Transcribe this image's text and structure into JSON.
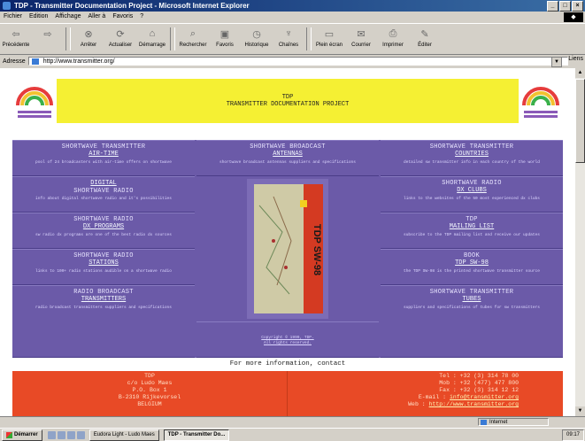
{
  "window": {
    "title": "TDP - Transmitter Documentation Project - Microsoft Internet Explorer",
    "win_buttons": [
      "_",
      "□",
      "×"
    ]
  },
  "menu": [
    "Fichier",
    "Edition",
    "Affichage",
    "Aller à",
    "Favoris",
    "?"
  ],
  "toolbar": [
    {
      "label": "Précédente",
      "icon": "back-icon"
    },
    {
      "label": "",
      "icon": "forward-icon"
    },
    {
      "label": "Arrêter",
      "icon": "stop-icon"
    },
    {
      "label": "Actualiser",
      "icon": "refresh-icon"
    },
    {
      "label": "Démarrage",
      "icon": "home-icon"
    },
    {
      "label": "Rechercher",
      "icon": "search-icon"
    },
    {
      "label": "Favoris",
      "icon": "favorites-icon"
    },
    {
      "label": "Historique",
      "icon": "history-icon"
    },
    {
      "label": "Chaînes",
      "icon": "channels-icon"
    },
    {
      "label": "Plein écran",
      "icon": "fullscreen-icon"
    },
    {
      "label": "Courrier",
      "icon": "mail-icon"
    },
    {
      "label": "Imprimer",
      "icon": "print-icon"
    },
    {
      "label": "Éditer",
      "icon": "edit-icon"
    }
  ],
  "address": {
    "label": "Adresse",
    "url": "http://www.transmitter.org/",
    "go": "Liens"
  },
  "banner": {
    "line1": "TDP",
    "line2": "TRANSMITTER DOCUMENTATION PROJECT"
  },
  "cells": [
    {
      "h": "SHORTWAVE TRANSMITTER",
      "link": "AIR-TIME",
      "desc": "pool of 24 broadcasters with air-time offers on shortwave"
    },
    {
      "h": "SHORTWAVE BROADCAST",
      "link": "ANTENNAS",
      "desc": "shortwave broadcast antennas suppliers and specifications"
    },
    {
      "h": "SHORTWAVE TRANSMITTER",
      "link": "COUNTRIES",
      "desc": "detailed sw transmitter info in each country of the world"
    },
    {
      "h": "",
      "link": "DIGITAL",
      "h2": "SHORTWAVE RADIO",
      "desc": "info about digital shortwave radio and it's possibilities"
    },
    {
      "h": "SHORTWAVE RADIO",
      "link": "DX CLUBS",
      "desc": "links to the websites of the 50 most experienced dx clubs"
    },
    {
      "h": "SHORTWAVE RADIO",
      "link": "DX PROGRAMS",
      "desc": "sw radio dx programs are one of the best radio dx sources"
    },
    {
      "h": "TDP",
      "link": "MAILING LIST",
      "desc": "subscribe to the TDP mailing list and receive our updates"
    },
    {
      "h": "SHORTWAVE RADIO",
      "link": "STATIONS",
      "desc": "links to 100+ radio stations audible on a shortwave radio"
    },
    {
      "h": "BOOK",
      "link": "TDP SW-98",
      "desc": "the TDP SW-98 is the printed shortwave transmitter source"
    },
    {
      "h": "RADIO BROADCAST",
      "link": "TRANSMITTERS",
      "desc": "radio broadcast transmitters suppliers and specifications"
    },
    {
      "h": "SHORTWAVE TRANSMITTER",
      "link": "TUBES",
      "desc": "suppliers and specifications of tubes for sw transmitters"
    }
  ],
  "book": {
    "title": "TDP SW-98"
  },
  "copyright": {
    "line1": "Copyright © 1999, TDP.",
    "line2": "All rights reserved."
  },
  "info": "For more information, contact",
  "contact": {
    "left": [
      "TDP",
      "c/o Ludo Maes",
      "P.O. Box 1",
      "B-2310 Rijkevorsel",
      "BELGIUM"
    ],
    "tel": "Tel : +32 (3) 314 78 00",
    "mob": "Mob : +32 (477) 477 800",
    "fax": "Fax : +32 (3) 314 12 12",
    "email_label": "E-mail :",
    "email": "info@transmitter.org",
    "web_label": "Web :",
    "web": "http://www.transmitter.org"
  },
  "status": {
    "left": "",
    "zone": "Internet"
  },
  "taskbar": {
    "start": "Démarrer",
    "tasks": [
      "Eudora Light - Ludo Maes",
      "TDP - Transmitter Do..."
    ],
    "clock": "09:17"
  },
  "colors": {
    "purple": "#6b5aa8",
    "yellow": "#f5f033",
    "orange": "#e84a26"
  }
}
